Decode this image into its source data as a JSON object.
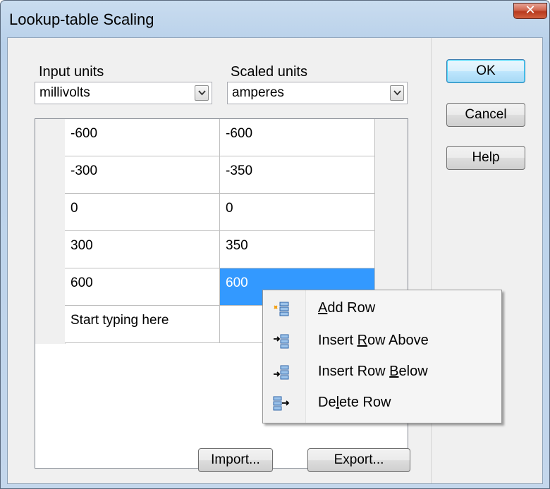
{
  "window": {
    "title": "Lookup-table Scaling",
    "close_glyph": "✕"
  },
  "input_units": {
    "label": "Input units",
    "value": "millivolts"
  },
  "scaled_units": {
    "label": "Scaled units",
    "value": "amperes"
  },
  "table": {
    "rows": [
      [
        "-600",
        "-600"
      ],
      [
        "-300",
        "-350"
      ],
      [
        "0",
        "0"
      ],
      [
        "300",
        "350"
      ],
      [
        "600",
        "600"
      ],
      [
        "Start typing here",
        ""
      ]
    ],
    "selected_cell": [
      4,
      1
    ]
  },
  "buttons": {
    "ok": "OK",
    "cancel": "Cancel",
    "help": "Help",
    "import": "Import...",
    "export": "Export..."
  },
  "context_menu": {
    "items": [
      {
        "pre": "",
        "u": "A",
        "post": "dd Row",
        "icon": "add-row-icon"
      },
      {
        "pre": "Insert ",
        "u": "R",
        "post": "ow Above",
        "icon": "insert-row-above-icon"
      },
      {
        "pre": "Insert Row ",
        "u": "B",
        "post": "elow",
        "icon": "insert-row-below-icon"
      },
      {
        "pre": "De",
        "u": "l",
        "post": "ete Row",
        "icon": "delete-row-icon"
      }
    ]
  },
  "colors": {
    "selection": "#3399ff",
    "close_button": "#c94a2e",
    "title_bar": "#b9d1ea"
  }
}
